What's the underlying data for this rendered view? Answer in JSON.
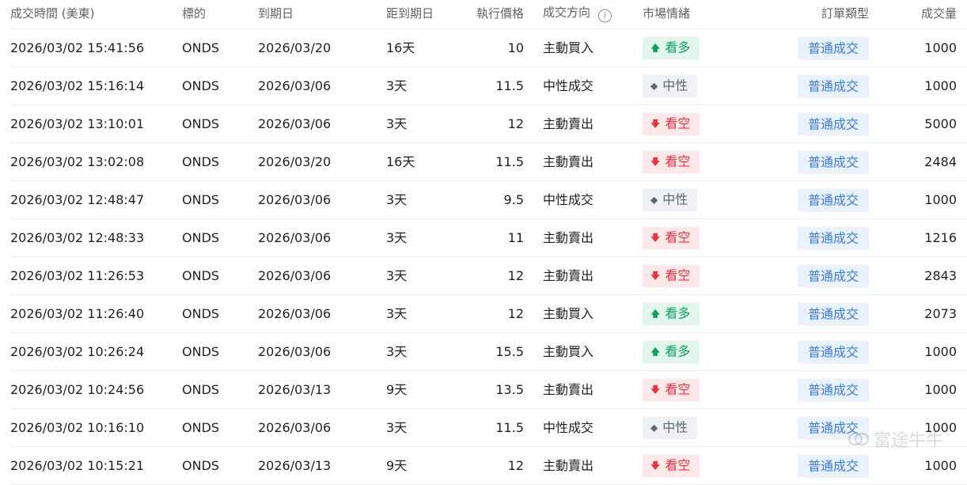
{
  "headers": {
    "time": "成交時間 (美東)",
    "symbol": "標的",
    "expiry": "到期日",
    "dte": "距到期日",
    "price": "執行價格",
    "direction": "成交方向",
    "sentiment": "市場情緒",
    "order_type": "訂單類型",
    "volume": "成交量"
  },
  "sentiment_icons": {
    "bull": "arrow-up-icon",
    "bear": "arrow-down-icon",
    "neutral": "diamond-icon"
  },
  "colors": {
    "bull": "#12a25f",
    "bear": "#e8343f",
    "neutral": "#5d6675",
    "order_type": "#3a7bd5"
  },
  "rows": [
    {
      "time": "2026/03/02 15:41:56",
      "symbol": "ONDS",
      "expiry": "2026/03/20",
      "dte": "16天",
      "price": "10",
      "direction": "主動買入",
      "sentiment": "看多",
      "sentiment_type": "bull",
      "order_type": "普通成交",
      "volume": "1000"
    },
    {
      "time": "2026/03/02 15:16:14",
      "symbol": "ONDS",
      "expiry": "2026/03/06",
      "dte": "3天",
      "price": "11.5",
      "direction": "中性成交",
      "sentiment": "中性",
      "sentiment_type": "neutral",
      "order_type": "普通成交",
      "volume": "1000"
    },
    {
      "time": "2026/03/02 13:10:01",
      "symbol": "ONDS",
      "expiry": "2026/03/06",
      "dte": "3天",
      "price": "12",
      "direction": "主動賣出",
      "sentiment": "看空",
      "sentiment_type": "bear",
      "order_type": "普通成交",
      "volume": "5000"
    },
    {
      "time": "2026/03/02 13:02:08",
      "symbol": "ONDS",
      "expiry": "2026/03/20",
      "dte": "16天",
      "price": "11.5",
      "direction": "主動賣出",
      "sentiment": "看空",
      "sentiment_type": "bear",
      "order_type": "普通成交",
      "volume": "2484"
    },
    {
      "time": "2026/03/02 12:48:47",
      "symbol": "ONDS",
      "expiry": "2026/03/06",
      "dte": "3天",
      "price": "9.5",
      "direction": "中性成交",
      "sentiment": "中性",
      "sentiment_type": "neutral",
      "order_type": "普通成交",
      "volume": "1000"
    },
    {
      "time": "2026/03/02 12:48:33",
      "symbol": "ONDS",
      "expiry": "2026/03/06",
      "dte": "3天",
      "price": "11",
      "direction": "主動賣出",
      "sentiment": "看空",
      "sentiment_type": "bear",
      "order_type": "普通成交",
      "volume": "1216"
    },
    {
      "time": "2026/03/02 11:26:53",
      "symbol": "ONDS",
      "expiry": "2026/03/06",
      "dte": "3天",
      "price": "12",
      "direction": "主動賣出",
      "sentiment": "看空",
      "sentiment_type": "bear",
      "order_type": "普通成交",
      "volume": "2843"
    },
    {
      "time": "2026/03/02 11:26:40",
      "symbol": "ONDS",
      "expiry": "2026/03/06",
      "dte": "3天",
      "price": "12",
      "direction": "主動買入",
      "sentiment": "看多",
      "sentiment_type": "bull",
      "order_type": "普通成交",
      "volume": "2073"
    },
    {
      "time": "2026/03/02 10:26:24",
      "symbol": "ONDS",
      "expiry": "2026/03/06",
      "dte": "3天",
      "price": "15.5",
      "direction": "主動買入",
      "sentiment": "看多",
      "sentiment_type": "bull",
      "order_type": "普通成交",
      "volume": "1000"
    },
    {
      "time": "2026/03/02 10:24:56",
      "symbol": "ONDS",
      "expiry": "2026/03/13",
      "dte": "9天",
      "price": "13.5",
      "direction": "主動賣出",
      "sentiment": "看空",
      "sentiment_type": "bear",
      "order_type": "普通成交",
      "volume": "1000"
    },
    {
      "time": "2026/03/02 10:16:10",
      "symbol": "ONDS",
      "expiry": "2026/03/06",
      "dte": "3天",
      "price": "11.5",
      "direction": "中性成交",
      "sentiment": "中性",
      "sentiment_type": "neutral",
      "order_type": "普通成交",
      "volume": "1000"
    },
    {
      "time": "2026/03/02 10:15:21",
      "symbol": "ONDS",
      "expiry": "2026/03/13",
      "dte": "9天",
      "price": "12",
      "direction": "主動賣出",
      "sentiment": "看空",
      "sentiment_type": "bear",
      "order_type": "普通成交",
      "volume": "1000"
    }
  ],
  "watermark": {
    "text": "富途牛牛",
    "icon": "futu-logo-icon"
  }
}
